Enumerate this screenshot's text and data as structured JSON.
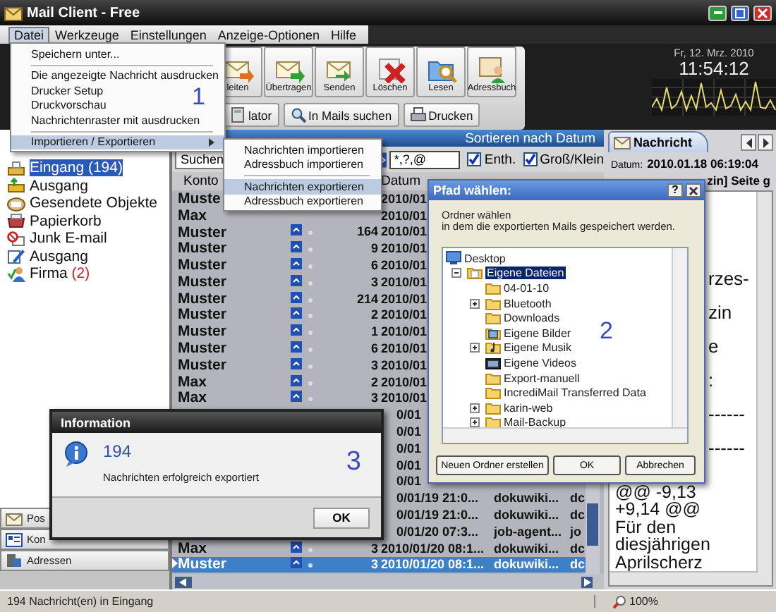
{
  "window": {
    "title": "Mail Client - Free"
  },
  "menu_bar": [
    {
      "label": "Datei",
      "selected": true
    },
    {
      "label": "Werkzeuge",
      "selected": false
    },
    {
      "label": "Einstellungen",
      "selected": false
    },
    {
      "label": "Anzeige-Optionen",
      "selected": false
    },
    {
      "label": "Hilfe",
      "selected": false
    }
  ],
  "toolbar": {
    "buttons": [
      {
        "label": "leiten",
        "kind": "forward"
      },
      {
        "label": "Übertragen",
        "kind": "transfer"
      },
      {
        "label": "Senden",
        "kind": "send"
      },
      {
        "label": "Löschen",
        "kind": "delete"
      },
      {
        "label": "Lesen",
        "kind": "read"
      },
      {
        "label": "Adressbuch",
        "kind": "addressbook"
      }
    ],
    "small_buttons": [
      {
        "label": "lator",
        "kind": "calc"
      },
      {
        "label": "In Mails suchen",
        "kind": "search"
      },
      {
        "label": "Drucken",
        "kind": "print"
      }
    ]
  },
  "clock": {
    "date": "Fr, 12. Mrz. 2010",
    "time": "11:54:12"
  },
  "sidebar": {
    "folders": [
      {
        "label": "Eingang",
        "count": "(194)",
        "kind": "inbox",
        "selected": true
      },
      {
        "label": "Ausgang",
        "kind": "outbox",
        "selected": false
      },
      {
        "label": "Gesendete Objekte",
        "kind": "sent",
        "selected": false
      },
      {
        "label": "Papierkorb",
        "kind": "trash",
        "selected": false
      },
      {
        "label": "Junk E-mail",
        "kind": "junk",
        "selected": false
      },
      {
        "label": "Ausgang",
        "kind": "draft",
        "selected": false
      },
      {
        "label": "Firma",
        "count": "(2)",
        "kind": "group",
        "selected": false
      }
    ],
    "nav": [
      {
        "label": "Pos",
        "kind": "post"
      },
      {
        "label": "Kon",
        "kind": "contacts"
      },
      {
        "label": "Adressen",
        "kind": "address"
      }
    ]
  },
  "message_list": {
    "header": "Sortieren nach Datum",
    "search_mode": "Suchen",
    "search_value": "*,?,@",
    "options": [
      {
        "label": "Enth.",
        "checked": true
      },
      {
        "label": "Groß/Klein",
        "checked": true
      }
    ],
    "columns": [
      "Konto",
      "Datum"
    ],
    "rows": [
      {
        "kind": "bare",
        "selected": false,
        "konto": "Muste",
        "datum": "2010/01"
      },
      {
        "kind": "bare",
        "selected": false,
        "konto": "Max",
        "datum": "2010/01"
      },
      {
        "kind": "full",
        "selected": false,
        "konto": "Muster",
        "column_3": "164",
        "datum": "2010/01"
      },
      {
        "kind": "full",
        "selected": false,
        "konto": "Muster",
        "column_3": "9",
        "datum": "2010/01"
      },
      {
        "kind": "full",
        "selected": false,
        "konto": "Muster",
        "column_3": "6",
        "datum": "2010/01"
      },
      {
        "kind": "full",
        "selected": false,
        "konto": "Muster",
        "column_3": "3",
        "datum": "2010/01"
      },
      {
        "kind": "full",
        "selected": false,
        "konto": "Muster",
        "column_3": "214",
        "datum": "2010/01"
      },
      {
        "kind": "full",
        "selected": false,
        "konto": "Muster",
        "column_3": "2",
        "datum": "2010/01"
      },
      {
        "kind": "full",
        "selected": false,
        "konto": "Muster",
        "column_3": "1",
        "datum": "2010/01"
      },
      {
        "kind": "full",
        "selected": false,
        "konto": "Muster",
        "column_3": "6",
        "datum": "2010/01"
      },
      {
        "kind": "full",
        "selected": false,
        "konto": "Muster",
        "column_3": "3",
        "datum": "2010/01"
      },
      {
        "kind": "full",
        "selected": false,
        "konto": "Max",
        "column_3": "2",
        "datum": "2010/01"
      },
      {
        "kind": "full",
        "selected": false,
        "konto": "Max",
        "column_3": "3",
        "datum": "2010/01"
      },
      {
        "kind": "obscured",
        "selected": false,
        "datum": "0/01"
      },
      {
        "kind": "obscured",
        "selected": false,
        "datum": "0/01"
      },
      {
        "kind": "obscured",
        "selected": false,
        "datum": "0/01"
      },
      {
        "kind": "obscured",
        "selected": false,
        "datum": "0/01"
      },
      {
        "kind": "obscured",
        "selected": false,
        "datum": "0/01"
      },
      {
        "kind": "obscured",
        "selected": false,
        "datum": "0/01/19 21:0...",
        "column_4": "dokuwiki...",
        "column_5": "dc"
      },
      {
        "kind": "obscured",
        "selected": false,
        "datum": "0/01/19 21:0...",
        "column_4": "dokuwiki...",
        "column_5": "dc"
      },
      {
        "kind": "obscured",
        "selected": false,
        "datum": "0/01/20 07:3...",
        "column_4": "job-agent...",
        "column_5": "jo"
      },
      {
        "kind": "full",
        "selected": false,
        "konto": "Max",
        "column_3": "3",
        "datum": "2010/01/20 08:1...",
        "column_4": "dokuwiki...",
        "column_5": "dc"
      },
      {
        "kind": "full",
        "selected": true,
        "konto": "Muster",
        "column_3": "3",
        "datum": "2010/01/20 08:1...",
        "column_4": "dokuwiki...",
        "column_5": "dc"
      }
    ]
  },
  "preview": {
    "tab": "Nachricht",
    "date_label": "Datum:",
    "date": "2010.01.18 06:19:04",
    "subject": "zin] Seite g",
    "body": [
      {
        "kind": "partial",
        "text": "rzes-"
      },
      {
        "kind": "partial",
        "text": "zin"
      },
      {
        "kind": "partial",
        "text": "e"
      },
      {
        "kind": "partial",
        "text": ":"
      },
      {
        "kind": "partial",
        "text": "------"
      },
      {
        "kind": "partial",
        "text": "------"
      },
      {
        "kind": "full",
        "text": "@@ -9,13"
      },
      {
        "kind": "full",
        "text": "+9,14 @@"
      },
      {
        "kind": "full",
        "text": "Für den"
      },
      {
        "kind": "full",
        "text": "diesjährigen"
      },
      {
        "kind": "full",
        "text": "Aprilscherz"
      }
    ]
  },
  "status_bar": {
    "text": "194 Nachricht(en) in Eingang",
    "zoom": "100%"
  },
  "file_menu": {
    "callout": "1",
    "items": [
      {
        "kind": "item",
        "label": "Speichern unter...",
        "selected": false
      },
      {
        "kind": "separator"
      },
      {
        "kind": "item",
        "label": "Die angezeigte Nachricht ausdrucken",
        "selected": false
      },
      {
        "kind": "item",
        "label": "Drucker Setup",
        "selected": false
      },
      {
        "kind": "item",
        "label": "Druckvorschau",
        "selected": false
      },
      {
        "kind": "item",
        "label": "Nachrichtenraster mit ausdrucken",
        "selected": false
      },
      {
        "kind": "separator"
      },
      {
        "kind": "submenu",
        "label": "Importieren / Exportieren",
        "selected": true
      }
    ]
  },
  "submenu": {
    "items": [
      {
        "kind": "item",
        "label": "Nachrichten importieren",
        "selected": false
      },
      {
        "kind": "item",
        "label": "Adressbuch importieren",
        "selected": false
      },
      {
        "kind": "separator"
      },
      {
        "kind": "item",
        "label": "Nachrichten exportieren",
        "selected": true
      },
      {
        "kind": "item",
        "label": "Adressbuch exportieren",
        "selected": false
      }
    ]
  },
  "path_dialog": {
    "title": "Pfad wählen:",
    "help_button": "?",
    "prompt": [
      "Ordner wählen",
      "in dem die exportierten Mails gespeichert werden."
    ],
    "callout": "2",
    "tree": [
      {
        "label": "Desktop",
        "kind": "desktop",
        "selected": false,
        "children": [
          {
            "label": "Eigene Dateien",
            "kind": "documents",
            "selected": true,
            "expanded": true,
            "children": [
              {
                "label": "04-01-10",
                "kind": "folder",
                "selected": false
              },
              {
                "label": "Bluetooth",
                "kind": "folder",
                "selected": false,
                "expanded": false
              },
              {
                "label": "Downloads",
                "kind": "folder",
                "selected": false
              },
              {
                "label": "Eigene Bilder",
                "kind": "pictures",
                "selected": false
              },
              {
                "label": "Eigene Musik",
                "kind": "music",
                "selected": false,
                "expanded": false
              },
              {
                "label": "Eigene Videos",
                "kind": "videos",
                "selected": false
              },
              {
                "label": "Export-manuell",
                "kind": "folder",
                "selected": false
              },
              {
                "label": "IncrediMail Transferred Data",
                "kind": "folder",
                "selected": false
              },
              {
                "label": "karin-web",
                "kind": "folder",
                "selected": false,
                "expanded": false
              },
              {
                "label": "Mail-Backup",
                "kind": "folder",
                "selected": false,
                "expanded": false
              }
            ]
          }
        ]
      }
    ],
    "buttons": [
      "Neuen Ordner erstellen",
      "OK",
      "Abbrechen"
    ]
  },
  "info_dialog": {
    "title": "Information",
    "count": "194",
    "message": "Nachrichten erfolgreich exportiert",
    "button": "OK",
    "callout": "3"
  }
}
